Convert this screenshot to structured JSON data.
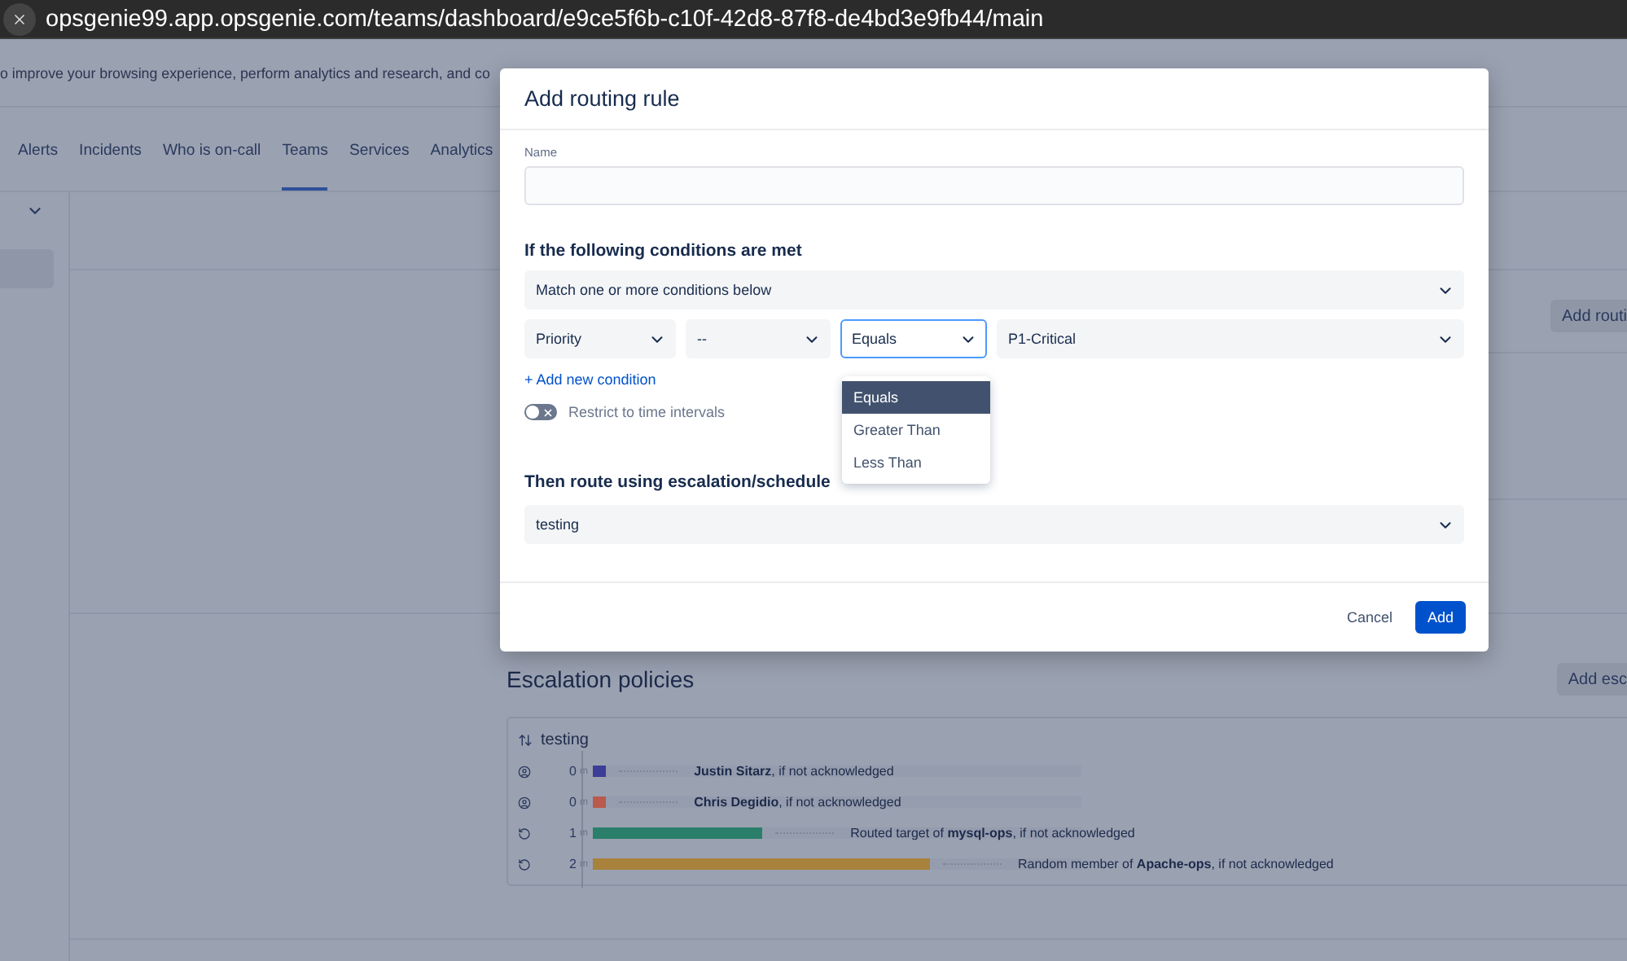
{
  "browser": {
    "url": "opsgenie99.app.opsgenie.com/teams/dashboard/e9ce5f6b-c10f-42d8-87f8-de4bd3e9fb44/main"
  },
  "banner": {
    "text": "o improve your browsing experience, perform analytics and research, and co"
  },
  "nav": {
    "tabs": [
      {
        "label": "Alerts",
        "selected": false
      },
      {
        "label": "Incidents",
        "selected": false
      },
      {
        "label": "Who is on-call",
        "selected": false
      },
      {
        "label": "Teams",
        "selected": true
      },
      {
        "label": "Services",
        "selected": false
      },
      {
        "label": "Analytics",
        "selected": false
      }
    ]
  },
  "sidebar": {
    "items": [
      {
        "selected": true
      }
    ]
  },
  "routing": {
    "add_button": "Add routi"
  },
  "escalation": {
    "title": "Escalation policies",
    "add_button": "Add esc",
    "policies": [
      {
        "name": "testing",
        "steps": [
          {
            "kind": "user",
            "minutes": "0",
            "unit": "m",
            "color": "#3b3d96",
            "level": 0.027,
            "text": "**Justin Sitarz**, if not acknowledged"
          },
          {
            "kind": "user",
            "minutes": "0",
            "unit": "m",
            "color": "#b85a4c",
            "level": 0.027,
            "text": "**Chris Degidio**, if not acknowledged"
          },
          {
            "kind": "group",
            "minutes": "1",
            "unit": "m",
            "color": "#2a7f6a",
            "level": 0.347,
            "text": "Routed target of **mysql-ops**, if not acknowledged"
          },
          {
            "kind": "group",
            "minutes": "2",
            "unit": "m",
            "color": "#a8823c",
            "level": 0.69,
            "text": "Random member of **Apache-ops**, if not acknowledged"
          }
        ]
      }
    ]
  },
  "modal": {
    "title": "Add routing rule",
    "name_label": "Name",
    "conditions_heading": "If the following conditions are met",
    "match": {
      "value": "Match one or more conditions below"
    },
    "condition": {
      "field": "Priority",
      "subfield": "--",
      "operator": {
        "value": "Equals",
        "open": true,
        "options": [
          {
            "label": "Equals",
            "selected": true
          },
          {
            "label": "Greater Than",
            "selected": false
          },
          {
            "label": "Less Than",
            "selected": false
          }
        ]
      },
      "value": "P1-Critical"
    },
    "add_condition": "+ Add new condition",
    "restrict": {
      "label": "Restrict to time intervals",
      "on": false
    },
    "route_heading": "Then route using escalation/schedule",
    "route": {
      "value": "testing"
    },
    "cancel": "Cancel",
    "add": "Add"
  }
}
